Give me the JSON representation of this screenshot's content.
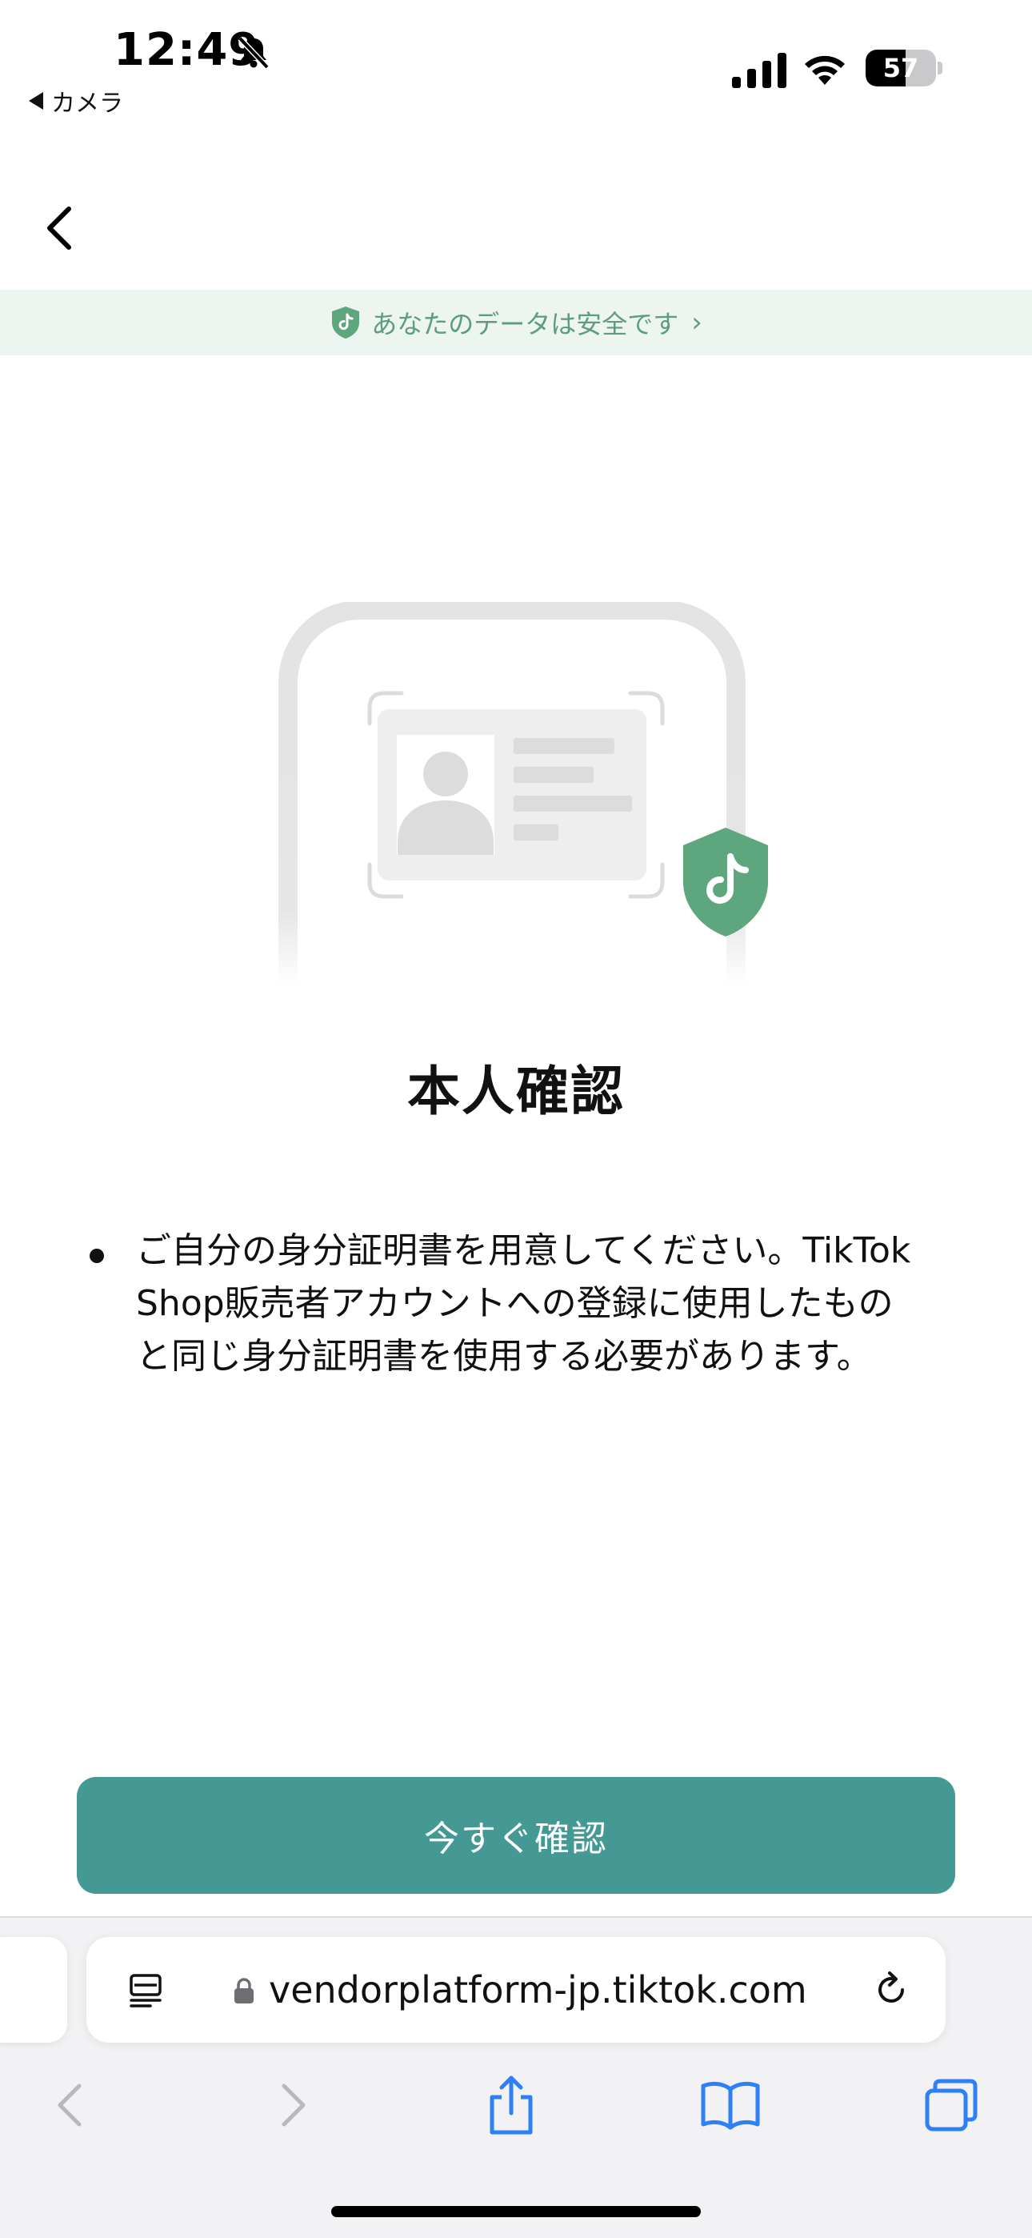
{
  "status_bar": {
    "time": "12:49",
    "back_app_label": "カメラ",
    "battery_level": "57",
    "battery_fraction": 0.57
  },
  "banner": {
    "text": "あなたのデータは安全です",
    "chevron": "›"
  },
  "main": {
    "title": "本人確認",
    "description": "ご自分の身分証明書を用意してください。TikTok Shop販売者アカウントへの登録に使用したものと同じ身分証明書を使用する必要があります。",
    "primary_button": "今すぐ確認"
  },
  "browser": {
    "url": "vendorplatform-jp.tiktok.com"
  },
  "colors": {
    "accent": "#459995",
    "shield_green": "#5ea67d",
    "banner_bg": "#edf5f1",
    "banner_text": "#5d9c80",
    "ios_blue": "#2f7ff5"
  },
  "icons": [
    "bell-off-icon",
    "signal-icon",
    "wifi-icon",
    "battery-icon",
    "chevron-left-icon",
    "shield-icon",
    "id-card-icon",
    "reader-icon",
    "lock-icon",
    "reload-icon",
    "back-icon",
    "forward-icon",
    "share-icon",
    "bookmarks-icon",
    "tabs-icon"
  ]
}
